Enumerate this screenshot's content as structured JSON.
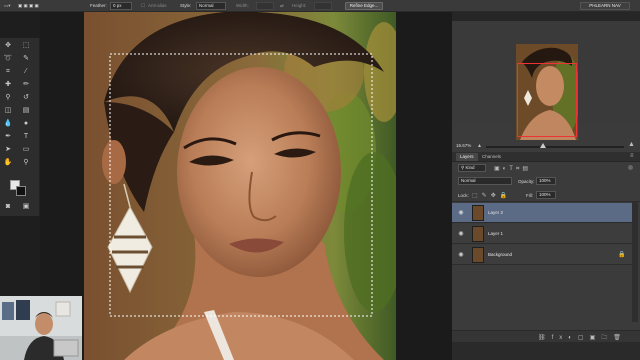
{
  "options_bar": {
    "feather_label": "Feather:",
    "feather_value": "0 px",
    "antialias_label": "Anti-alias",
    "style_label": "Style:",
    "style_value": "Normal",
    "width_label": "Width:",
    "height_label": "Height:",
    "refine_edge_button": "Refine Edge...",
    "workspace": "PHLEARN NAV"
  },
  "navigator": {
    "tab_label": "Navigator",
    "zoom_value": "16.67%"
  },
  "layers_panel": {
    "tabs": [
      {
        "label": "Layers"
      },
      {
        "label": "Channels"
      }
    ],
    "filter_kind": "Kind",
    "blend_mode": "Normal",
    "opacity_label": "Opacity:",
    "opacity_value": "100%",
    "lock_label": "Lock:",
    "fill_label": "Fill:",
    "fill_value": "100%",
    "layers": [
      {
        "name": "Layer 2",
        "selected": true
      },
      {
        "name": "Layer 1",
        "selected": false
      },
      {
        "name": "Background",
        "selected": false
      }
    ]
  },
  "colors": {
    "selected_layer": "#5b6b86",
    "navigator_frame": "#ee3333",
    "panel_bg": "#3b3b3b",
    "toolbar_bg": "#2d2d2d"
  }
}
